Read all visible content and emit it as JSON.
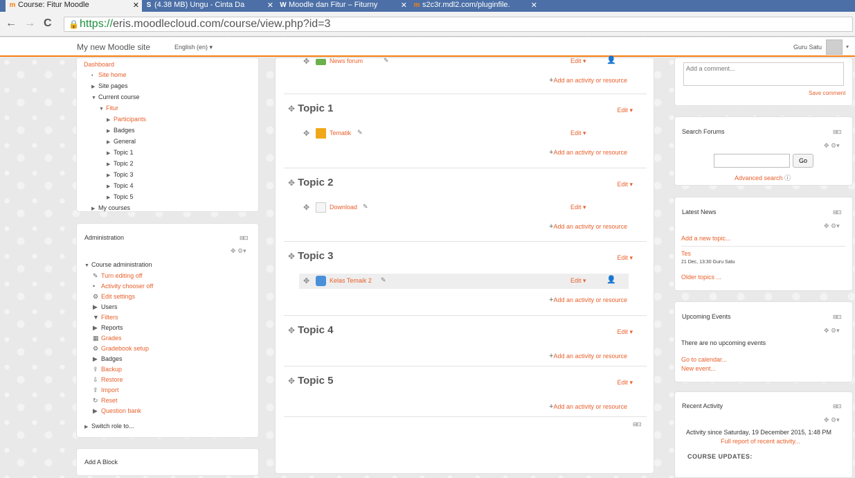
{
  "browser": {
    "tabs": [
      {
        "label": "Course: Fitur Moodle",
        "icon": "moodle-icon",
        "active": true
      },
      {
        "label": "(4.38 MB) Ungu - Cinta Da",
        "icon": "slideshare-icon",
        "active": false
      },
      {
        "label": "Moodle dan Fitur – Fiturny",
        "icon": "wordpress-icon",
        "active": false
      },
      {
        "label": "s2c3r.mdl2.com/pluginfile.",
        "icon": "moodle-m-icon",
        "active": false
      }
    ],
    "url_scheme": "https://",
    "url_rest": "eris.moodlecloud.com/course/view.php?id=3"
  },
  "header": {
    "site_name": "My new Moodle site",
    "language": "English (en) ▾",
    "user_name": "Guru Satu"
  },
  "navigation": {
    "items": [
      {
        "label": "Dashboard",
        "level": 0,
        "style": "link",
        "twisty": ""
      },
      {
        "label": "Site home",
        "level": 1,
        "style": "link",
        "twisty": "•"
      },
      {
        "label": "Site pages",
        "level": 1,
        "style": "plain",
        "twisty": "▶"
      },
      {
        "label": "Current course",
        "level": 1,
        "style": "plain",
        "twisty": "▼"
      },
      {
        "label": "Fitur",
        "level": 2,
        "style": "link",
        "twisty": "▼"
      },
      {
        "label": "Participants",
        "level": 3,
        "style": "link",
        "twisty": "▶"
      },
      {
        "label": "Badges",
        "level": 3,
        "style": "plain",
        "twisty": "▶"
      },
      {
        "label": "General",
        "level": 3,
        "style": "plain",
        "twisty": "▶"
      },
      {
        "label": "Topic 1",
        "level": 3,
        "style": "plain",
        "twisty": "▶"
      },
      {
        "label": "Topic 2",
        "level": 3,
        "style": "plain",
        "twisty": "▶"
      },
      {
        "label": "Topic 3",
        "level": 3,
        "style": "plain",
        "twisty": "▶"
      },
      {
        "label": "Topic 4",
        "level": 3,
        "style": "plain",
        "twisty": "▶"
      },
      {
        "label": "Topic 5",
        "level": 3,
        "style": "plain",
        "twisty": "▶"
      },
      {
        "label": "My courses",
        "level": 1,
        "style": "plain",
        "twisty": "▶"
      }
    ]
  },
  "administration": {
    "title": "Administration",
    "root": "Course administration",
    "items": [
      {
        "label": "Turn editing off",
        "icon": "pencil-icon",
        "glyph": "✎",
        "style": "link"
      },
      {
        "label": "Activity chooser off",
        "icon": "bullet-icon",
        "glyph": "•",
        "style": "link"
      },
      {
        "label": "Edit settings",
        "icon": "gear-icon",
        "glyph": "⚙",
        "style": "link"
      },
      {
        "label": "Users",
        "icon": "expand-icon",
        "glyph": "▶",
        "style": "plain"
      },
      {
        "label": "Filters",
        "icon": "filter-icon",
        "glyph": "▼",
        "style": "link"
      },
      {
        "label": "Reports",
        "icon": "expand-icon",
        "glyph": "▶",
        "style": "plain"
      },
      {
        "label": "Grades",
        "icon": "grades-icon",
        "glyph": "▦",
        "style": "link"
      },
      {
        "label": "Gradebook setup",
        "icon": "gear-icon",
        "glyph": "⚙",
        "style": "link"
      },
      {
        "label": "Badges",
        "icon": "expand-icon",
        "glyph": "▶",
        "style": "plain"
      },
      {
        "label": "Backup",
        "icon": "backup-icon",
        "glyph": "⇪",
        "style": "link"
      },
      {
        "label": "Restore",
        "icon": "restore-icon",
        "glyph": "⇩",
        "style": "link"
      },
      {
        "label": "Import",
        "icon": "import-icon",
        "glyph": "⇪",
        "style": "link"
      },
      {
        "label": "Reset",
        "icon": "reset-icon",
        "glyph": "↻",
        "style": "link"
      },
      {
        "label": "Question bank",
        "icon": "expand-icon",
        "glyph": "▶",
        "style": "link"
      }
    ],
    "switch_role": "Switch role to..."
  },
  "add_block": {
    "title": "Add A Block"
  },
  "course": {
    "top_activity": {
      "name": "News forum",
      "edit": "Edit ▾"
    },
    "add_label": "Add an activity or resource",
    "sections": [
      {
        "title": "Topic 1",
        "edit": "Edit ▾",
        "activity": {
          "name": "Tematik",
          "icon": "folder-icon",
          "edit": "Edit ▾",
          "highlight": false,
          "user": false
        }
      },
      {
        "title": "Topic 2",
        "edit": "Edit ▾",
        "activity": {
          "name": "Download",
          "icon": "file-icon",
          "edit": "Edit ▾",
          "highlight": false,
          "user": false
        }
      },
      {
        "title": "Topic 3",
        "edit": "Edit ▾",
        "activity": {
          "name": "Kelas Temaik 2",
          "icon": "database-icon",
          "edit": "Edit ▾",
          "highlight": true,
          "user": true
        }
      },
      {
        "title": "Topic 4",
        "edit": "Edit ▾",
        "activity": null
      },
      {
        "title": "Topic 5",
        "edit": "Edit ▾",
        "activity": null
      }
    ]
  },
  "comments": {
    "placeholder": "Add a comment...",
    "save": "Save comment"
  },
  "search_forums": {
    "title": "Search Forums",
    "button": "Go",
    "advanced": "Advanced search"
  },
  "latest_news": {
    "title": "Latest News",
    "add": "Add a new topic...",
    "post_title": "Tes",
    "post_meta": "21 Dec, 13:30 Guru Satu",
    "older": "Older topics ..."
  },
  "upcoming_events": {
    "title": "Upcoming Events",
    "empty": "There are no upcoming events",
    "calendar": "Go to calendar...",
    "new_event": "New event..."
  },
  "recent_activity": {
    "title": "Recent Activity",
    "since": "Activity since Saturday, 19 December 2015, 1:48 PM",
    "full_report": "Full report of recent activity...",
    "updates": "COURSE UPDATES:"
  }
}
